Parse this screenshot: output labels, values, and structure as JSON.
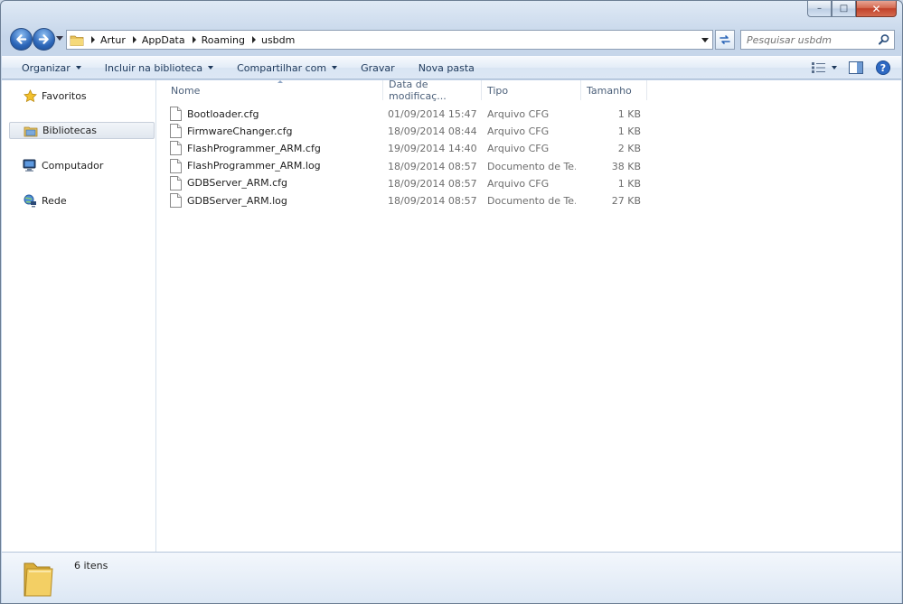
{
  "window": {
    "caption": {
      "minimize": "–",
      "maximize": "□",
      "close": "✕"
    }
  },
  "address": {
    "crumbs": [
      "Artur",
      "AppData",
      "Roaming",
      "usbdm"
    ]
  },
  "search": {
    "placeholder": "Pesquisar usbdm"
  },
  "toolbar": {
    "organize": "Organizar",
    "include_library": "Incluir na biblioteca",
    "share_with": "Compartilhar com",
    "burn": "Gravar",
    "new_folder": "Nova pasta"
  },
  "sidebar": {
    "items": [
      {
        "label": "Favoritos",
        "icon": "star-icon"
      },
      {
        "label": "Bibliotecas",
        "icon": "libraries-icon"
      },
      {
        "label": "Computador",
        "icon": "computer-icon"
      },
      {
        "label": "Rede",
        "icon": "network-icon"
      }
    ]
  },
  "columns": {
    "name": "Nome",
    "date": "Data de modificaç...",
    "type": "Tipo",
    "size": "Tamanho"
  },
  "files": [
    {
      "name": "Bootloader.cfg",
      "date": "01/09/2014 15:47",
      "type": "Arquivo CFG",
      "size": "1 KB"
    },
    {
      "name": "FirmwareChanger.cfg",
      "date": "18/09/2014 08:44",
      "type": "Arquivo CFG",
      "size": "1 KB"
    },
    {
      "name": "FlashProgrammer_ARM.cfg",
      "date": "19/09/2014 14:40",
      "type": "Arquivo CFG",
      "size": "2 KB"
    },
    {
      "name": "FlashProgrammer_ARM.log",
      "date": "18/09/2014 08:57",
      "type": "Documento de Te...",
      "size": "38 KB"
    },
    {
      "name": "GDBServer_ARM.cfg",
      "date": "18/09/2014 08:57",
      "type": "Arquivo CFG",
      "size": "1 KB"
    },
    {
      "name": "GDBServer_ARM.log",
      "date": "18/09/2014 08:57",
      "type": "Documento de Te...",
      "size": "27 KB"
    }
  ],
  "details": {
    "count": "6 itens"
  },
  "colors": {
    "accent": "#2c66b8",
    "header_text": "#4c607a",
    "toolbar_text": "#1e395b"
  }
}
